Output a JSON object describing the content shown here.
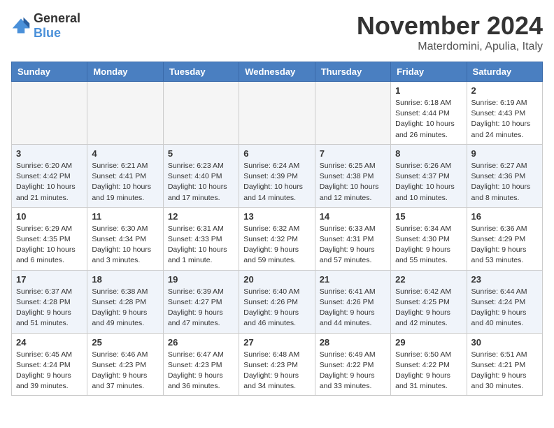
{
  "logo": {
    "general": "General",
    "blue": "Blue"
  },
  "header": {
    "month": "November 2024",
    "location": "Materdomini, Apulia, Italy"
  },
  "weekdays": [
    "Sunday",
    "Monday",
    "Tuesday",
    "Wednesday",
    "Thursday",
    "Friday",
    "Saturday"
  ],
  "rows": [
    {
      "alt": false,
      "cells": [
        {
          "day": "",
          "info": ""
        },
        {
          "day": "",
          "info": ""
        },
        {
          "day": "",
          "info": ""
        },
        {
          "day": "",
          "info": ""
        },
        {
          "day": "",
          "info": ""
        },
        {
          "day": "1",
          "info": "Sunrise: 6:18 AM\nSunset: 4:44 PM\nDaylight: 10 hours and 26 minutes."
        },
        {
          "day": "2",
          "info": "Sunrise: 6:19 AM\nSunset: 4:43 PM\nDaylight: 10 hours and 24 minutes."
        }
      ]
    },
    {
      "alt": true,
      "cells": [
        {
          "day": "3",
          "info": "Sunrise: 6:20 AM\nSunset: 4:42 PM\nDaylight: 10 hours and 21 minutes."
        },
        {
          "day": "4",
          "info": "Sunrise: 6:21 AM\nSunset: 4:41 PM\nDaylight: 10 hours and 19 minutes."
        },
        {
          "day": "5",
          "info": "Sunrise: 6:23 AM\nSunset: 4:40 PM\nDaylight: 10 hours and 17 minutes."
        },
        {
          "day": "6",
          "info": "Sunrise: 6:24 AM\nSunset: 4:39 PM\nDaylight: 10 hours and 14 minutes."
        },
        {
          "day": "7",
          "info": "Sunrise: 6:25 AM\nSunset: 4:38 PM\nDaylight: 10 hours and 12 minutes."
        },
        {
          "day": "8",
          "info": "Sunrise: 6:26 AM\nSunset: 4:37 PM\nDaylight: 10 hours and 10 minutes."
        },
        {
          "day": "9",
          "info": "Sunrise: 6:27 AM\nSunset: 4:36 PM\nDaylight: 10 hours and 8 minutes."
        }
      ]
    },
    {
      "alt": false,
      "cells": [
        {
          "day": "10",
          "info": "Sunrise: 6:29 AM\nSunset: 4:35 PM\nDaylight: 10 hours and 6 minutes."
        },
        {
          "day": "11",
          "info": "Sunrise: 6:30 AM\nSunset: 4:34 PM\nDaylight: 10 hours and 3 minutes."
        },
        {
          "day": "12",
          "info": "Sunrise: 6:31 AM\nSunset: 4:33 PM\nDaylight: 10 hours and 1 minute."
        },
        {
          "day": "13",
          "info": "Sunrise: 6:32 AM\nSunset: 4:32 PM\nDaylight: 9 hours and 59 minutes."
        },
        {
          "day": "14",
          "info": "Sunrise: 6:33 AM\nSunset: 4:31 PM\nDaylight: 9 hours and 57 minutes."
        },
        {
          "day": "15",
          "info": "Sunrise: 6:34 AM\nSunset: 4:30 PM\nDaylight: 9 hours and 55 minutes."
        },
        {
          "day": "16",
          "info": "Sunrise: 6:36 AM\nSunset: 4:29 PM\nDaylight: 9 hours and 53 minutes."
        }
      ]
    },
    {
      "alt": true,
      "cells": [
        {
          "day": "17",
          "info": "Sunrise: 6:37 AM\nSunset: 4:28 PM\nDaylight: 9 hours and 51 minutes."
        },
        {
          "day": "18",
          "info": "Sunrise: 6:38 AM\nSunset: 4:28 PM\nDaylight: 9 hours and 49 minutes."
        },
        {
          "day": "19",
          "info": "Sunrise: 6:39 AM\nSunset: 4:27 PM\nDaylight: 9 hours and 47 minutes."
        },
        {
          "day": "20",
          "info": "Sunrise: 6:40 AM\nSunset: 4:26 PM\nDaylight: 9 hours and 46 minutes."
        },
        {
          "day": "21",
          "info": "Sunrise: 6:41 AM\nSunset: 4:26 PM\nDaylight: 9 hours and 44 minutes."
        },
        {
          "day": "22",
          "info": "Sunrise: 6:42 AM\nSunset: 4:25 PM\nDaylight: 9 hours and 42 minutes."
        },
        {
          "day": "23",
          "info": "Sunrise: 6:44 AM\nSunset: 4:24 PM\nDaylight: 9 hours and 40 minutes."
        }
      ]
    },
    {
      "alt": false,
      "cells": [
        {
          "day": "24",
          "info": "Sunrise: 6:45 AM\nSunset: 4:24 PM\nDaylight: 9 hours and 39 minutes."
        },
        {
          "day": "25",
          "info": "Sunrise: 6:46 AM\nSunset: 4:23 PM\nDaylight: 9 hours and 37 minutes."
        },
        {
          "day": "26",
          "info": "Sunrise: 6:47 AM\nSunset: 4:23 PM\nDaylight: 9 hours and 36 minutes."
        },
        {
          "day": "27",
          "info": "Sunrise: 6:48 AM\nSunset: 4:23 PM\nDaylight: 9 hours and 34 minutes."
        },
        {
          "day": "28",
          "info": "Sunrise: 6:49 AM\nSunset: 4:22 PM\nDaylight: 9 hours and 33 minutes."
        },
        {
          "day": "29",
          "info": "Sunrise: 6:50 AM\nSunset: 4:22 PM\nDaylight: 9 hours and 31 minutes."
        },
        {
          "day": "30",
          "info": "Sunrise: 6:51 AM\nSunset: 4:21 PM\nDaylight: 9 hours and 30 minutes."
        }
      ]
    }
  ]
}
